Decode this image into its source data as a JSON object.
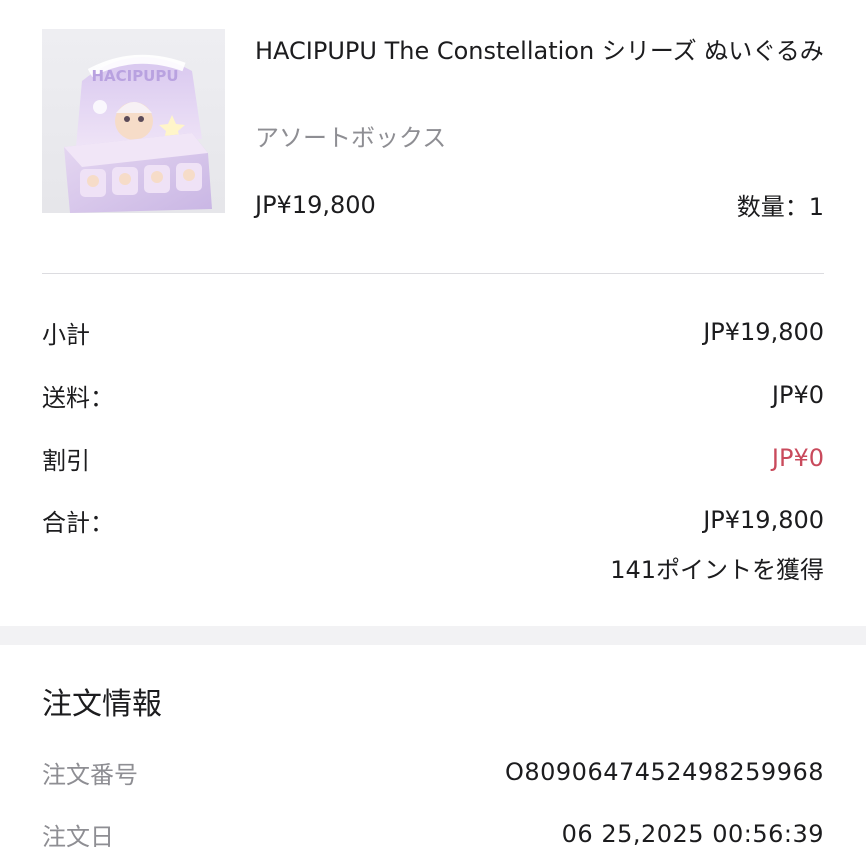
{
  "product": {
    "title": "HACIPUPU The Constellation シリーズ ぬいぐるみ",
    "variant": "アソートボックス",
    "price": "JP¥19,800",
    "quantity": "数量：1",
    "image_text": "HACIPUPU"
  },
  "summary": {
    "subtotal_label": "小計",
    "subtotal_value": "JP¥19,800",
    "shipping_label": "送料：",
    "shipping_value": "JP¥0",
    "discount_label": "割引",
    "discount_value": "JP¥0",
    "total_label": "合計：",
    "total_value": "JP¥19,800",
    "points": "141ポイントを獲得"
  },
  "order_info": {
    "heading": "注文情報",
    "number_label": "注文番号",
    "number_value": "O809064745249825996​8",
    "date_label": "注文日",
    "date_value": "06 25,2025 00:56:39"
  },
  "colors": {
    "discount": "#c94a5c",
    "muted": "#8e8e93",
    "divider": "#dcdce0",
    "section_gap": "#f2f2f4"
  }
}
